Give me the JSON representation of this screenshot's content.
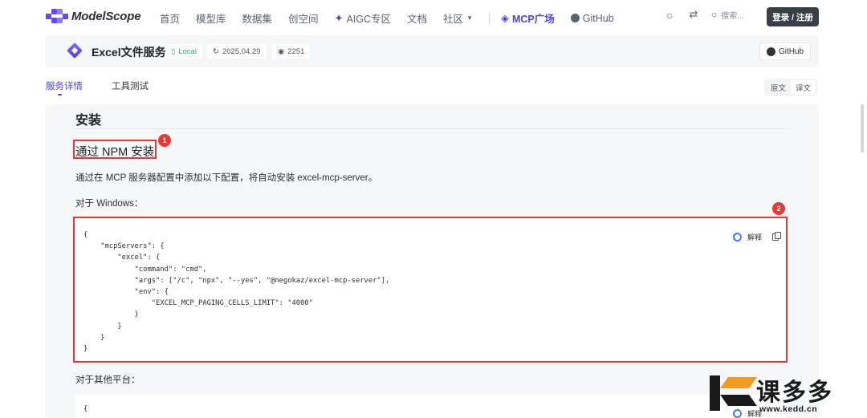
{
  "topnav": {
    "logo_text": "ModelScope",
    "items": [
      {
        "label": "首页"
      },
      {
        "label": "模型库"
      },
      {
        "label": "数据集"
      },
      {
        "label": "创空间"
      },
      {
        "label": "AIGC专区"
      },
      {
        "label": "文档"
      },
      {
        "label": "社区"
      },
      {
        "label": "MCP广场"
      },
      {
        "label": "GitHub"
      }
    ],
    "search_placeholder": "搜索...",
    "login_label": "登录 / 注册"
  },
  "service": {
    "title": "Excel文件服务",
    "tag_local": "Local",
    "date": "2025.04.29",
    "views": "2251",
    "github_label": "GitHub"
  },
  "tabs": {
    "details": "服务详情",
    "tool_test": "工具测试"
  },
  "lang": {
    "original": "原文",
    "translated": "译文"
  },
  "content": {
    "heading": "安装",
    "subheading": "通过 NPM 安装",
    "description": "通过在 MCP 服务器配置中添加以下配置，将自动安装 excel-mcp-server。",
    "windows_label": "对于 Windows：",
    "windows_code": "{\n    \"mcpServers\": {\n        \"excel\": {\n            \"command\": \"cmd\",\n            \"args\": [\"/c\", \"npx\", \"--yes\", \"@negokaz/excel-mcp-server\"],\n            \"env\": {\n                \"EXCEL_MCP_PAGING_CELLS_LIMIT\": \"4000\"\n            }\n        }\n    }\n}",
    "explain_label": "解释",
    "other_label": "对于其他平台：",
    "other_code": "{",
    "explain_label_2": "解释"
  },
  "annotations": {
    "badge_1": "1",
    "badge_2": "2"
  },
  "watermark": {
    "text": "课多多",
    "url": "www.kedd.cn"
  }
}
